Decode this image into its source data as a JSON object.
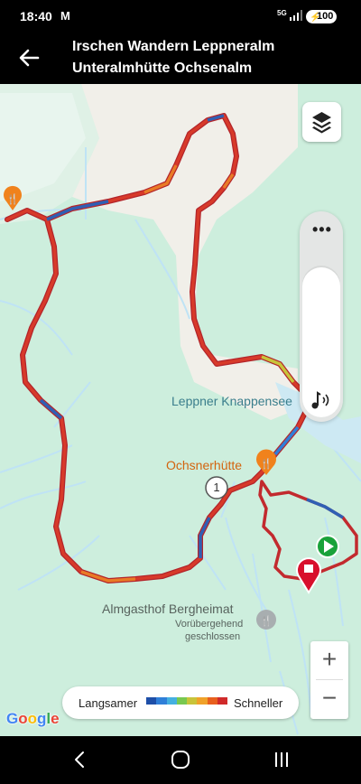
{
  "status_bar": {
    "time": "18:40",
    "mail_icon": "M",
    "network": "5G",
    "battery": "100"
  },
  "header": {
    "title_line1": "Irschen Wandern Leppneralm",
    "title_line2": "Unteralmhütte Ochsenalm"
  },
  "map": {
    "labels": {
      "lake": "Leppner Knappensee",
      "hut": "Ochsnerhütte",
      "inn": "Almgasthof Bergheimat",
      "inn_status_line1": "Vorübergehend",
      "inn_status_line2": "geschlossen"
    },
    "waypoint_number": "1",
    "more_label": "•••"
  },
  "controls": {
    "zoom_in": "+",
    "zoom_out": "−"
  },
  "legend": {
    "slow": "Langsamer",
    "fast": "Schneller",
    "colors": [
      "#1e4fa8",
      "#2f7fd8",
      "#44b0e0",
      "#78c850",
      "#c8c43a",
      "#f0a22a",
      "#e8601e",
      "#d02a2a"
    ]
  },
  "google_logo": {
    "letters": [
      "G",
      "o",
      "o",
      "g",
      "l",
      "e"
    ],
    "colors": [
      "#4285F4",
      "#EA4335",
      "#FBBC05",
      "#4285F4",
      "#34A853",
      "#EA4335"
    ]
  },
  "colors": {
    "track_red": "#d2302a",
    "track_blue": "#2f5fb4",
    "track_orange": "#e87b26",
    "marker_start": "#19a23a",
    "marker_end": "#d80f2c",
    "poi_orange": "#f0821c"
  }
}
